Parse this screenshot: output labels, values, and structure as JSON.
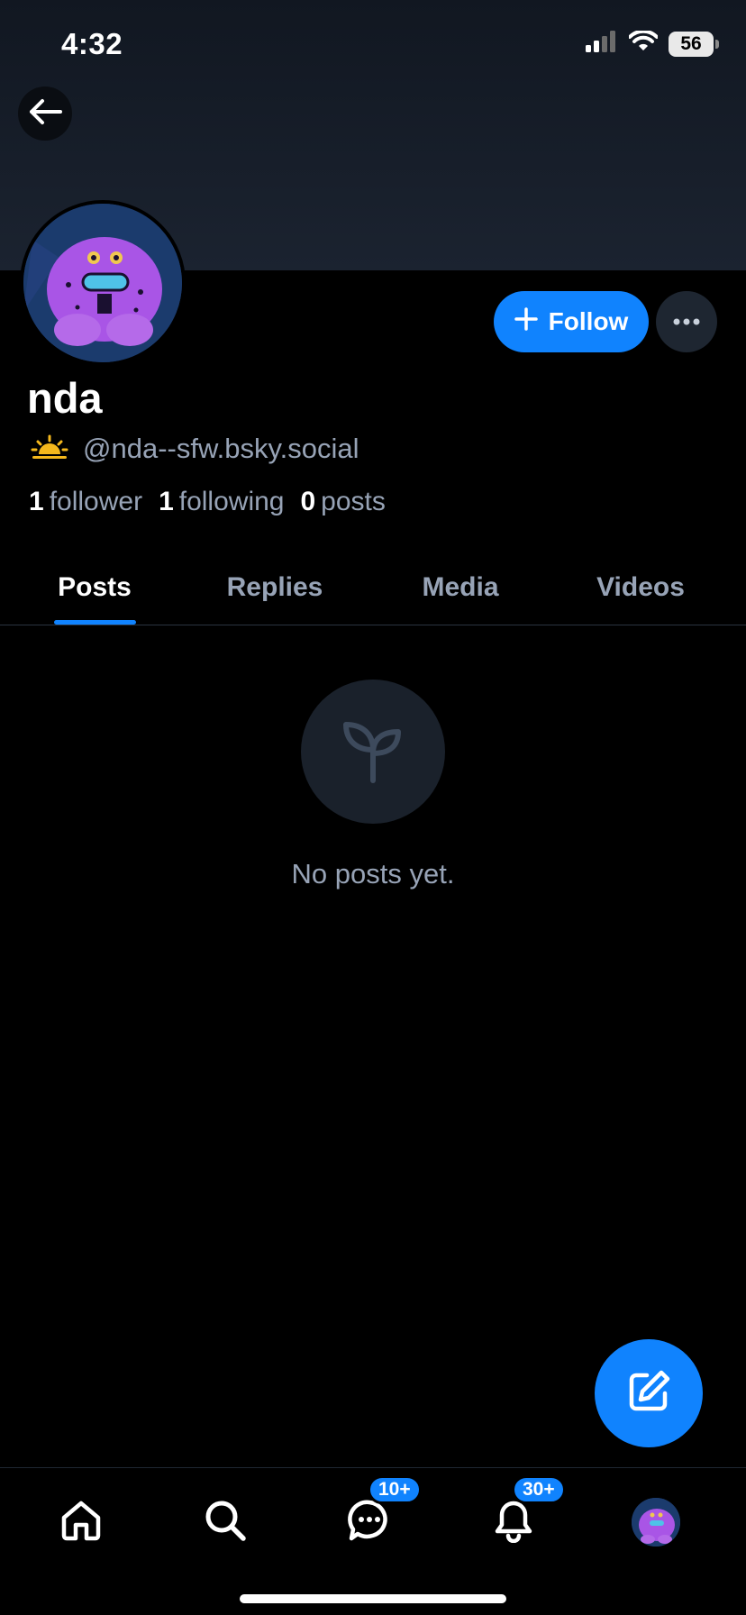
{
  "status_bar": {
    "time": "4:32",
    "battery": "56"
  },
  "profile": {
    "display_name": "nda",
    "handle": "@nda--sfw.bsky.social",
    "followers_count": "1",
    "followers_label": "follower",
    "following_count": "1",
    "following_label": "following",
    "posts_count": "0",
    "posts_label": "posts"
  },
  "actions": {
    "follow_label": "Follow"
  },
  "tabs": [
    {
      "label": "Posts",
      "active": true
    },
    {
      "label": "Replies",
      "active": false
    },
    {
      "label": "Media",
      "active": false
    },
    {
      "label": "Videos",
      "active": false
    }
  ],
  "empty_state": {
    "icon": "seedling-icon",
    "text": "No posts yet."
  },
  "bottom_nav": {
    "items": [
      {
        "icon": "home-icon"
      },
      {
        "icon": "search-icon"
      },
      {
        "icon": "chat-icon",
        "badge": "10+"
      },
      {
        "icon": "bell-icon",
        "badge": "30+"
      },
      {
        "icon": "profile-avatar"
      }
    ]
  },
  "colors": {
    "accent": "#1083fe",
    "muted": "#97a3b6",
    "background": "#000000"
  }
}
